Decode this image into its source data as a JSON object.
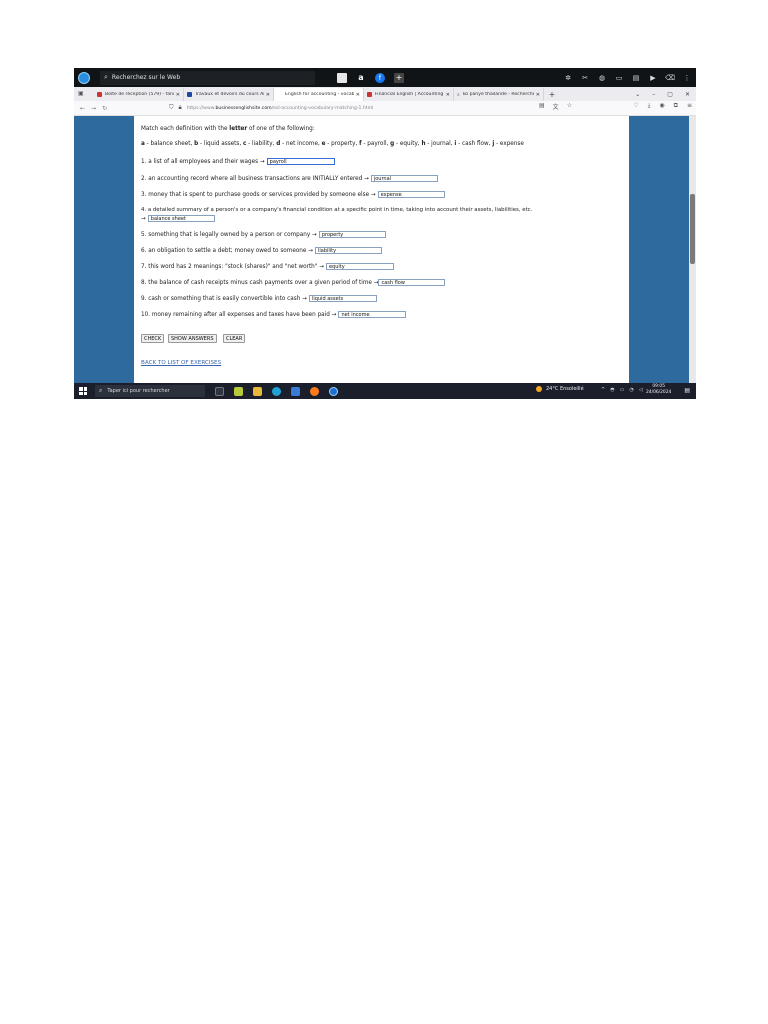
{
  "topbar": {
    "search_placeholder": "Recherchez sur le Web"
  },
  "tabs": [
    {
      "label": "Boîte de réception (579) - fanch",
      "icon": "gmail-icon"
    },
    {
      "label": "Travaux et devoirs du cours Ang",
      "icon": "classroom-icon"
    },
    {
      "label": "English for accounting - vocabulary",
      "icon": "",
      "active": true
    },
    {
      "label": "Financial English | Accounting |",
      "icon": "site-icon"
    },
    {
      "label": "ko panye thailande - Recherche",
      "icon": "search-icon"
    }
  ],
  "address": {
    "prefix": "https://www.",
    "host": "businessenglishsite.com",
    "path": "/esl-accounting-vocabulary-matching-1.html"
  },
  "exercise": {
    "instruction_prefix": "Match each definition with the ",
    "instruction_bold": "letter",
    "instruction_suffix": " of one of the following:",
    "options_line": [
      {
        "k": "a",
        "v": " - balance sheet, "
      },
      {
        "k": "b",
        "v": " - liquid assets, "
      },
      {
        "k": "c",
        "v": " - liability, "
      },
      {
        "k": "d",
        "v": " - net income, "
      },
      {
        "k": "e",
        "v": " - property, "
      },
      {
        "k": "f",
        "v": " - payroll, "
      },
      {
        "k": "g",
        "v": " - equity, "
      },
      {
        "k": "h",
        "v": " - journal, "
      },
      {
        "k": "i",
        "v": " - cash flow, "
      },
      {
        "k": "j",
        "v": " - expense"
      }
    ],
    "questions": [
      {
        "text": "1. a list of all employees and their wages →",
        "answer": "payroll"
      },
      {
        "text": "2. an accounting record where all business transactions are INITIALLY entered →",
        "answer": "journal"
      },
      {
        "text": "3. money that is spent to purchase goods or services provided by someone else →",
        "answer": "expense"
      },
      {
        "text": "4. a detailed summary of a person's or a company's financial condition at a specific point in time, taking into account their assets, liabilities, etc.",
        "cont": "→",
        "answer": "balance sheet"
      },
      {
        "text": "5. something that is legally owned by a person or company →",
        "answer": "property"
      },
      {
        "text": "6. an obligation to settle a debt; money owed to someone →",
        "answer": "liability"
      },
      {
        "text": "7. this word has 2 meanings: \"stock (shares)\" and \"net worth\" →",
        "answer": "equity"
      },
      {
        "text": "8. the balance of cash receipts minus cash payments over a given period of time →",
        "answer": "cash flow"
      },
      {
        "text": "9. cash or something that is easily convertible into cash →",
        "answer": "liquid assets"
      },
      {
        "text": "10. money remaining after all expenses and taxes have been paid →",
        "answer": "net income"
      }
    ],
    "buttons": {
      "check": "CHECK",
      "show": "SHOW ANSWERS",
      "clear": "CLEAR"
    },
    "back_link": "BACK TO LIST OF EXERCISES"
  },
  "taskbar": {
    "search_placeholder": "Taper ici pour rechercher",
    "weather": "24°C Ensoleillé",
    "time": "09:05",
    "date": "24/06/2024"
  },
  "colors": {
    "page_bg": "#2f6a9f",
    "input_border": "#8aa0c0",
    "link": "#3b66b0"
  }
}
